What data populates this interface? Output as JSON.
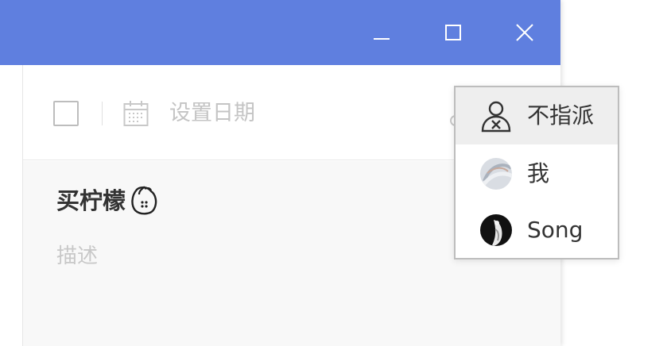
{
  "window_controls": {
    "minimize_icon": "minimize-icon",
    "maximize_icon": "maximize-icon",
    "close_icon": "close-icon"
  },
  "toolbar": {
    "set_date_label": "设置日期"
  },
  "task": {
    "title": "买柠檬",
    "description_placeholder": "描述"
  },
  "assign_menu": {
    "items": [
      {
        "label": "不指派",
        "icon": "unassign-user-icon"
      },
      {
        "label": "我",
        "icon": "avatar-me"
      },
      {
        "label": "Song",
        "icon": "avatar-song"
      }
    ]
  },
  "colors": {
    "titlebar": "#5f7fdf",
    "menu_highlight": "#eeeeee",
    "placeholder_text": "#c4c4c4"
  }
}
